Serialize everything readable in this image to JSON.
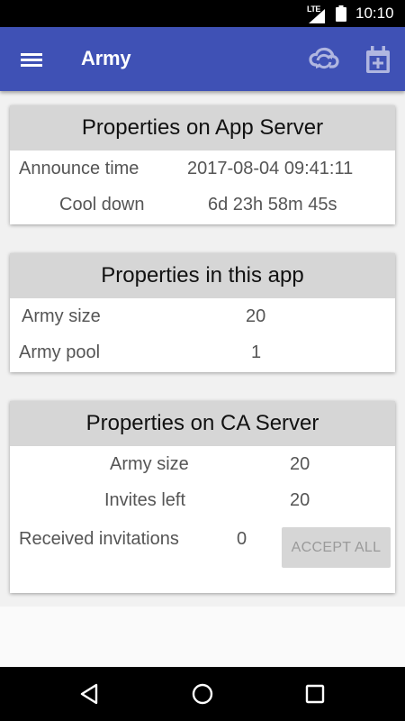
{
  "status_bar": {
    "network": "LTE",
    "time": "10:10",
    "icons": [
      "lte-signal-icon",
      "battery-icon"
    ]
  },
  "app_bar": {
    "title": "Army",
    "color": "#3f51b5",
    "icons": [
      "menu-icon",
      "sync-icon",
      "calendar-add-icon"
    ]
  },
  "cards": [
    {
      "header": "Properties on App Server",
      "rows": [
        {
          "label": "Announce time",
          "value": "2017-08-04 09:41:11"
        },
        {
          "label": "Cool down",
          "value": "6d 23h 58m 45s"
        }
      ]
    },
    {
      "header": "Properties in this app",
      "rows": [
        {
          "label": "Army size",
          "value": "20"
        },
        {
          "label": "Army pool",
          "value": "1"
        }
      ]
    },
    {
      "header": "Properties on CA Server",
      "rows": [
        {
          "label": "Army size",
          "value": "20"
        },
        {
          "label": "Invites left",
          "value": "20"
        },
        {
          "label": "Received invitations",
          "value": "0"
        }
      ],
      "button": {
        "label": "ACCEPT ALL",
        "enabled": false
      }
    }
  ],
  "nav_bar": {
    "icons": [
      "back-icon",
      "home-icon",
      "recents-icon"
    ]
  }
}
